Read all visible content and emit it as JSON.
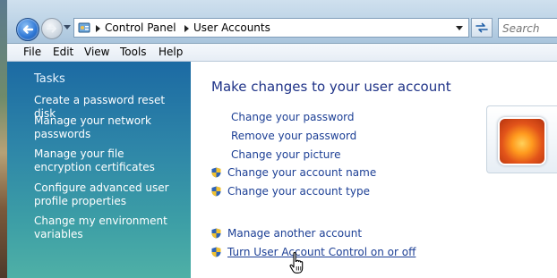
{
  "address_bar": {
    "breadcrumbs": [
      "Control Panel",
      "User Accounts"
    ],
    "search_placeholder": "Search"
  },
  "menu": [
    "File",
    "Edit",
    "View",
    "Tools",
    "Help"
  ],
  "tasks": {
    "title": "Tasks",
    "links": [
      "Create a password reset disk",
      "Manage your network passwords",
      "Manage your file encryption certificates",
      "Configure advanced user profile properties",
      "Change my environment variables"
    ]
  },
  "main": {
    "heading": "Make changes to your user account",
    "actions": [
      {
        "label": "Change your password",
        "shield": false
      },
      {
        "label": "Remove your password",
        "shield": false
      },
      {
        "label": "Change your picture",
        "shield": false
      },
      {
        "label": "Change your account name",
        "shield": true
      },
      {
        "label": "Change your account type",
        "shield": true
      }
    ],
    "other_actions": [
      {
        "label": "Manage another account",
        "shield": true
      },
      {
        "label": "Turn User Account Control on or off",
        "shield": true
      }
    ]
  },
  "colors": {
    "link": "#1c3f95",
    "heading": "#1e3287",
    "task_pane": "#2e86a8"
  },
  "icons": [
    "back-arrow-icon",
    "forward-arrow-icon",
    "control-panel-icon",
    "refresh-icon",
    "uac-shield-icon",
    "hand-cursor-icon"
  ]
}
